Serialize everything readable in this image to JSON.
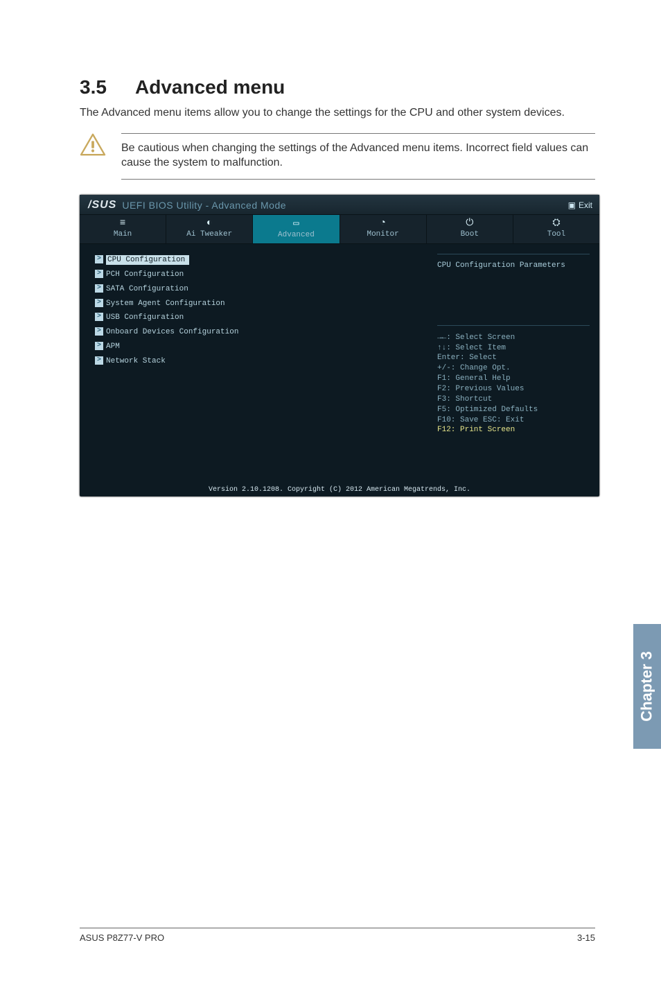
{
  "heading": {
    "number": "3.5",
    "title": "Advanced menu"
  },
  "intro": "The Advanced menu items allow you to change the settings for the CPU and other system devices.",
  "note": "Be cautious when changing the settings of the Advanced menu items. Incorrect field values can cause the system to malfunction.",
  "bios": {
    "logo": "/SUS",
    "title": "UEFI BIOS Utility - Advanced Mode",
    "exit": "Exit",
    "tabs": [
      "Main",
      "Ai Tweaker",
      "Advanced",
      "Monitor",
      "Boot",
      "Tool"
    ],
    "active_tab_idx": 2,
    "menu_items": [
      "CPU Configuration",
      "PCH Configuration",
      "SATA Configuration",
      "System Agent Configuration",
      "USB Configuration",
      "Onboard Devices Configuration",
      "APM",
      "Network Stack"
    ],
    "selected_idx": 0,
    "side_desc": "CPU Configuration Parameters",
    "help": [
      "→←: Select Screen",
      "↑↓: Select Item",
      "Enter: Select",
      "+/-: Change Opt.",
      "F1: General Help",
      "F2: Previous Values",
      "F3: Shortcut",
      "F5: Optimized Defaults",
      "F10: Save  ESC: Exit",
      "F12: Print Screen"
    ],
    "footer": "Version 2.10.1208. Copyright (C) 2012 American Megatrends, Inc."
  },
  "chapter_tab": "Chapter 3",
  "footer_left": "ASUS P8Z77-V PRO",
  "footer_right": "3-15"
}
